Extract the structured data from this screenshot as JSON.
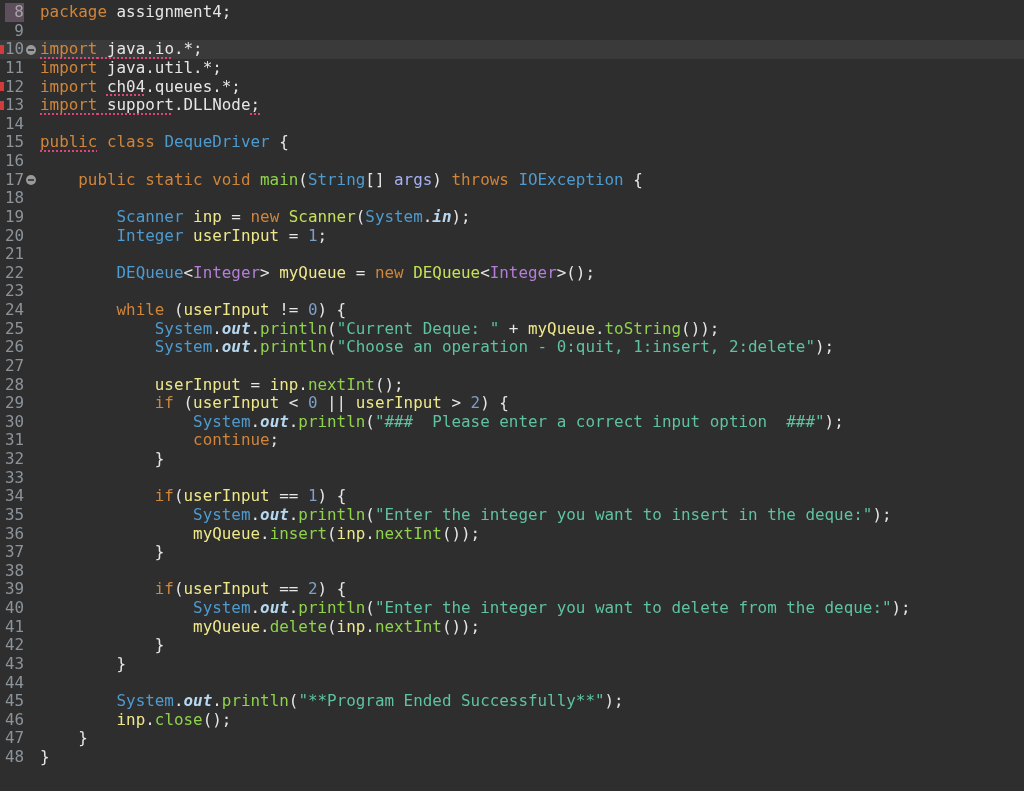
{
  "lines": [
    {
      "number": "8",
      "current": false,
      "highlighted": true,
      "tokens": [
        {
          "t": "package",
          "kind": "kw"
        },
        {
          "t": " assignment4;",
          "kind": "plain"
        }
      ]
    },
    {
      "number": "9",
      "current": false,
      "highlighted": false
    },
    {
      "number": "10",
      "current": true,
      "highlighted": false,
      "error": true,
      "foldable": true,
      "tokens": [
        {
          "t": "import",
          "kind": "kw",
          "warn": true
        },
        {
          "t": " java.io",
          "kind": "plain",
          "warn": true
        },
        {
          "t": ".*;",
          "kind": "plain"
        }
      ]
    },
    {
      "number": "11",
      "current": false,
      "highlighted": false,
      "tokens": [
        {
          "t": "import",
          "kind": "kw"
        },
        {
          "t": " java.util.*;",
          "kind": "plain"
        }
      ]
    },
    {
      "number": "12",
      "current": false,
      "highlighted": false,
      "error": true,
      "tokens": [
        {
          "t": "import ",
          "kind": "kw"
        },
        {
          "t": "ch04",
          "kind": "plain",
          "warn": true
        },
        {
          "t": ".queues.*;",
          "kind": "plain"
        }
      ]
    },
    {
      "number": "13",
      "current": false,
      "highlighted": false,
      "error": true,
      "tokens": [
        {
          "t": "import",
          "kind": "kw",
          "warn": true
        },
        {
          "t": " support",
          "kind": "plain",
          "warn": true
        },
        {
          "t": ".DLLNode",
          "kind": "plain"
        },
        {
          "t": ";",
          "kind": "plain",
          "warn": true
        }
      ]
    },
    {
      "number": "14",
      "current": false,
      "highlighted": false
    },
    {
      "number": "15",
      "current": false,
      "highlighted": false,
      "tokens": [
        {
          "t": "public",
          "kind": "kw",
          "warn": true
        },
        {
          "t": " class",
          "kind": "kw"
        },
        {
          "t": " DequeDriver",
          "kind": "type"
        },
        {
          "t": " {",
          "kind": "plain"
        }
      ]
    },
    {
      "number": "16",
      "current": false,
      "highlighted": false
    },
    {
      "number": "17",
      "current": false,
      "highlighted": false,
      "foldable": true,
      "tokens": [
        {
          "t": "    public static void",
          "kind": "kw"
        },
        {
          "t": " main",
          "kind": "method"
        },
        {
          "t": "(",
          "kind": "plain"
        },
        {
          "t": "String",
          "kind": "type"
        },
        {
          "t": "[] ",
          "kind": "plain"
        },
        {
          "t": "args",
          "kind": "param"
        },
        {
          "t": ") ",
          "kind": "plain"
        },
        {
          "t": "throws",
          "kind": "kw"
        },
        {
          "t": " IOException",
          "kind": "type"
        },
        {
          "t": " {",
          "kind": "plain"
        }
      ]
    },
    {
      "number": "18",
      "current": false,
      "highlighted": false
    },
    {
      "number": "19",
      "current": false,
      "highlighted": false,
      "tokens": [
        {
          "t": "        Scanner",
          "kind": "type"
        },
        {
          "t": " inp",
          "kind": "var"
        },
        {
          "t": " = ",
          "kind": "plain"
        },
        {
          "t": "new",
          "kind": "kw"
        },
        {
          "t": " Scanner",
          "kind": "ctor"
        },
        {
          "t": "(",
          "kind": "plain"
        },
        {
          "t": "System",
          "kind": "type"
        },
        {
          "t": ".",
          "kind": "plain"
        },
        {
          "t": "in",
          "kind": "field"
        },
        {
          "t": ");",
          "kind": "plain"
        }
      ]
    },
    {
      "number": "20",
      "current": false,
      "highlighted": false,
      "tokens": [
        {
          "t": "        Integer",
          "kind": "type"
        },
        {
          "t": " userInput",
          "kind": "var"
        },
        {
          "t": " = ",
          "kind": "plain"
        },
        {
          "t": "1",
          "kind": "num"
        },
        {
          "t": ";",
          "kind": "plain"
        }
      ]
    },
    {
      "number": "21",
      "current": false,
      "highlighted": false
    },
    {
      "number": "22",
      "current": false,
      "highlighted": false,
      "tokens": [
        {
          "t": "        DEQueue",
          "kind": "type"
        },
        {
          "t": "<",
          "kind": "plain"
        },
        {
          "t": "Integer",
          "kind": "typearg"
        },
        {
          "t": "> ",
          "kind": "plain"
        },
        {
          "t": "myQueue",
          "kind": "var"
        },
        {
          "t": " = ",
          "kind": "plain"
        },
        {
          "t": "new",
          "kind": "kw"
        },
        {
          "t": " DEQueue",
          "kind": "ctor"
        },
        {
          "t": "<",
          "kind": "plain"
        },
        {
          "t": "Integer",
          "kind": "typearg"
        },
        {
          "t": ">();",
          "kind": "plain"
        }
      ]
    },
    {
      "number": "23",
      "current": false,
      "highlighted": false
    },
    {
      "number": "24",
      "current": false,
      "highlighted": false,
      "tokens": [
        {
          "t": "        while",
          "kind": "kw"
        },
        {
          "t": " (",
          "kind": "plain"
        },
        {
          "t": "userInput",
          "kind": "var"
        },
        {
          "t": " != ",
          "kind": "plain"
        },
        {
          "t": "0",
          "kind": "num"
        },
        {
          "t": ") {",
          "kind": "plain"
        }
      ]
    },
    {
      "number": "25",
      "current": false,
      "highlighted": false,
      "tokens": [
        {
          "t": "            System",
          "kind": "type"
        },
        {
          "t": ".",
          "kind": "plain"
        },
        {
          "t": "out",
          "kind": "field"
        },
        {
          "t": ".",
          "kind": "plain"
        },
        {
          "t": "println",
          "kind": "method"
        },
        {
          "t": "(",
          "kind": "plain"
        },
        {
          "t": "\"Current Deque: \"",
          "kind": "str"
        },
        {
          "t": " + ",
          "kind": "plain"
        },
        {
          "t": "myQueue",
          "kind": "var"
        },
        {
          "t": ".",
          "kind": "plain"
        },
        {
          "t": "toString",
          "kind": "method"
        },
        {
          "t": "());",
          "kind": "plain"
        }
      ]
    },
    {
      "number": "26",
      "current": false,
      "highlighted": false,
      "tokens": [
        {
          "t": "            System",
          "kind": "type"
        },
        {
          "t": ".",
          "kind": "plain"
        },
        {
          "t": "out",
          "kind": "field"
        },
        {
          "t": ".",
          "kind": "plain"
        },
        {
          "t": "println",
          "kind": "method"
        },
        {
          "t": "(",
          "kind": "plain"
        },
        {
          "t": "\"Choose an operation - 0:quit, 1:insert, 2:delete\"",
          "kind": "str"
        },
        {
          "t": ");",
          "kind": "plain"
        }
      ]
    },
    {
      "number": "27",
      "current": false,
      "highlighted": false
    },
    {
      "number": "28",
      "current": false,
      "highlighted": false,
      "tokens": [
        {
          "t": "            userInput",
          "kind": "var"
        },
        {
          "t": " = ",
          "kind": "plain"
        },
        {
          "t": "inp",
          "kind": "var"
        },
        {
          "t": ".",
          "kind": "plain"
        },
        {
          "t": "nextInt",
          "kind": "method"
        },
        {
          "t": "();",
          "kind": "plain"
        }
      ]
    },
    {
      "number": "29",
      "current": false,
      "highlighted": false,
      "tokens": [
        {
          "t": "            if",
          "kind": "kw"
        },
        {
          "t": " (",
          "kind": "plain"
        },
        {
          "t": "userInput",
          "kind": "var"
        },
        {
          "t": " < ",
          "kind": "plain"
        },
        {
          "t": "0",
          "kind": "num"
        },
        {
          "t": " || ",
          "kind": "plain"
        },
        {
          "t": "userInput",
          "kind": "var"
        },
        {
          "t": " > ",
          "kind": "plain"
        },
        {
          "t": "2",
          "kind": "num"
        },
        {
          "t": ") {",
          "kind": "plain"
        }
      ]
    },
    {
      "number": "30",
      "current": false,
      "highlighted": false,
      "tokens": [
        {
          "t": "                System",
          "kind": "type"
        },
        {
          "t": ".",
          "kind": "plain"
        },
        {
          "t": "out",
          "kind": "field"
        },
        {
          "t": ".",
          "kind": "plain"
        },
        {
          "t": "println",
          "kind": "method"
        },
        {
          "t": "(",
          "kind": "plain"
        },
        {
          "t": "\"###  Please enter a correct input option  ###\"",
          "kind": "str"
        },
        {
          "t": ");",
          "kind": "plain"
        }
      ]
    },
    {
      "number": "31",
      "current": false,
      "highlighted": false,
      "tokens": [
        {
          "t": "                continue",
          "kind": "kw"
        },
        {
          "t": ";",
          "kind": "plain"
        }
      ]
    },
    {
      "number": "32",
      "current": false,
      "highlighted": false,
      "tokens": [
        {
          "t": "            }",
          "kind": "plain"
        }
      ]
    },
    {
      "number": "33",
      "current": false,
      "highlighted": false
    },
    {
      "number": "34",
      "current": false,
      "highlighted": false,
      "tokens": [
        {
          "t": "            if",
          "kind": "kw"
        },
        {
          "t": "(",
          "kind": "plain"
        },
        {
          "t": "userInput",
          "kind": "var"
        },
        {
          "t": " == ",
          "kind": "plain"
        },
        {
          "t": "1",
          "kind": "num"
        },
        {
          "t": ") {",
          "kind": "plain"
        }
      ]
    },
    {
      "number": "35",
      "current": false,
      "highlighted": false,
      "tokens": [
        {
          "t": "                System",
          "kind": "type"
        },
        {
          "t": ".",
          "kind": "plain"
        },
        {
          "t": "out",
          "kind": "field"
        },
        {
          "t": ".",
          "kind": "plain"
        },
        {
          "t": "println",
          "kind": "method"
        },
        {
          "t": "(",
          "kind": "plain"
        },
        {
          "t": "\"Enter the integer you want to insert in the deque:\"",
          "kind": "str"
        },
        {
          "t": ");",
          "kind": "plain"
        }
      ]
    },
    {
      "number": "36",
      "current": false,
      "highlighted": false,
      "tokens": [
        {
          "t": "                myQueue",
          "kind": "var"
        },
        {
          "t": ".",
          "kind": "plain"
        },
        {
          "t": "insert",
          "kind": "method"
        },
        {
          "t": "(",
          "kind": "plain"
        },
        {
          "t": "inp",
          "kind": "var"
        },
        {
          "t": ".",
          "kind": "plain"
        },
        {
          "t": "nextInt",
          "kind": "method"
        },
        {
          "t": "());",
          "kind": "plain"
        }
      ]
    },
    {
      "number": "37",
      "current": false,
      "highlighted": false,
      "tokens": [
        {
          "t": "            }",
          "kind": "plain"
        }
      ]
    },
    {
      "number": "38",
      "current": false,
      "highlighted": false
    },
    {
      "number": "39",
      "current": false,
      "highlighted": false,
      "tokens": [
        {
          "t": "            if",
          "kind": "kw"
        },
        {
          "t": "(",
          "kind": "plain"
        },
        {
          "t": "userInput",
          "kind": "var"
        },
        {
          "t": " == ",
          "kind": "plain"
        },
        {
          "t": "2",
          "kind": "num"
        },
        {
          "t": ") {",
          "kind": "plain"
        }
      ]
    },
    {
      "number": "40",
      "current": false,
      "highlighted": false,
      "tokens": [
        {
          "t": "                System",
          "kind": "type"
        },
        {
          "t": ".",
          "kind": "plain"
        },
        {
          "t": "out",
          "kind": "field"
        },
        {
          "t": ".",
          "kind": "plain"
        },
        {
          "t": "println",
          "kind": "method"
        },
        {
          "t": "(",
          "kind": "plain"
        },
        {
          "t": "\"Enter the integer you want to delete from the deque:\"",
          "kind": "str"
        },
        {
          "t": ");",
          "kind": "plain"
        }
      ]
    },
    {
      "number": "41",
      "current": false,
      "highlighted": false,
      "tokens": [
        {
          "t": "                myQueue",
          "kind": "var"
        },
        {
          "t": ".",
          "kind": "plain"
        },
        {
          "t": "delete",
          "kind": "method"
        },
        {
          "t": "(",
          "kind": "plain"
        },
        {
          "t": "inp",
          "kind": "var"
        },
        {
          "t": ".",
          "kind": "plain"
        },
        {
          "t": "nextInt",
          "kind": "method"
        },
        {
          "t": "());",
          "kind": "plain"
        }
      ]
    },
    {
      "number": "42",
      "current": false,
      "highlighted": false,
      "tokens": [
        {
          "t": "            }",
          "kind": "plain"
        }
      ]
    },
    {
      "number": "43",
      "current": false,
      "highlighted": false,
      "tokens": [
        {
          "t": "        }",
          "kind": "plain"
        }
      ]
    },
    {
      "number": "44",
      "current": false,
      "highlighted": false
    },
    {
      "number": "45",
      "current": false,
      "highlighted": false,
      "tokens": [
        {
          "t": "        System",
          "kind": "type"
        },
        {
          "t": ".",
          "kind": "plain"
        },
        {
          "t": "out",
          "kind": "field"
        },
        {
          "t": ".",
          "kind": "plain"
        },
        {
          "t": "println",
          "kind": "method"
        },
        {
          "t": "(",
          "kind": "plain"
        },
        {
          "t": "\"**Program Ended Successfully**\"",
          "kind": "str"
        },
        {
          "t": ");",
          "kind": "plain"
        }
      ]
    },
    {
      "number": "46",
      "current": false,
      "highlighted": false,
      "tokens": [
        {
          "t": "        inp",
          "kind": "var"
        },
        {
          "t": ".",
          "kind": "plain"
        },
        {
          "t": "close",
          "kind": "method"
        },
        {
          "t": "();",
          "kind": "plain"
        }
      ]
    },
    {
      "number": "47",
      "current": false,
      "highlighted": false,
      "tokens": [
        {
          "t": "    }",
          "kind": "plain"
        }
      ]
    },
    {
      "number": "48",
      "current": false,
      "highlighted": false,
      "tokens": [
        {
          "t": "}",
          "kind": "plain"
        }
      ]
    }
  ]
}
